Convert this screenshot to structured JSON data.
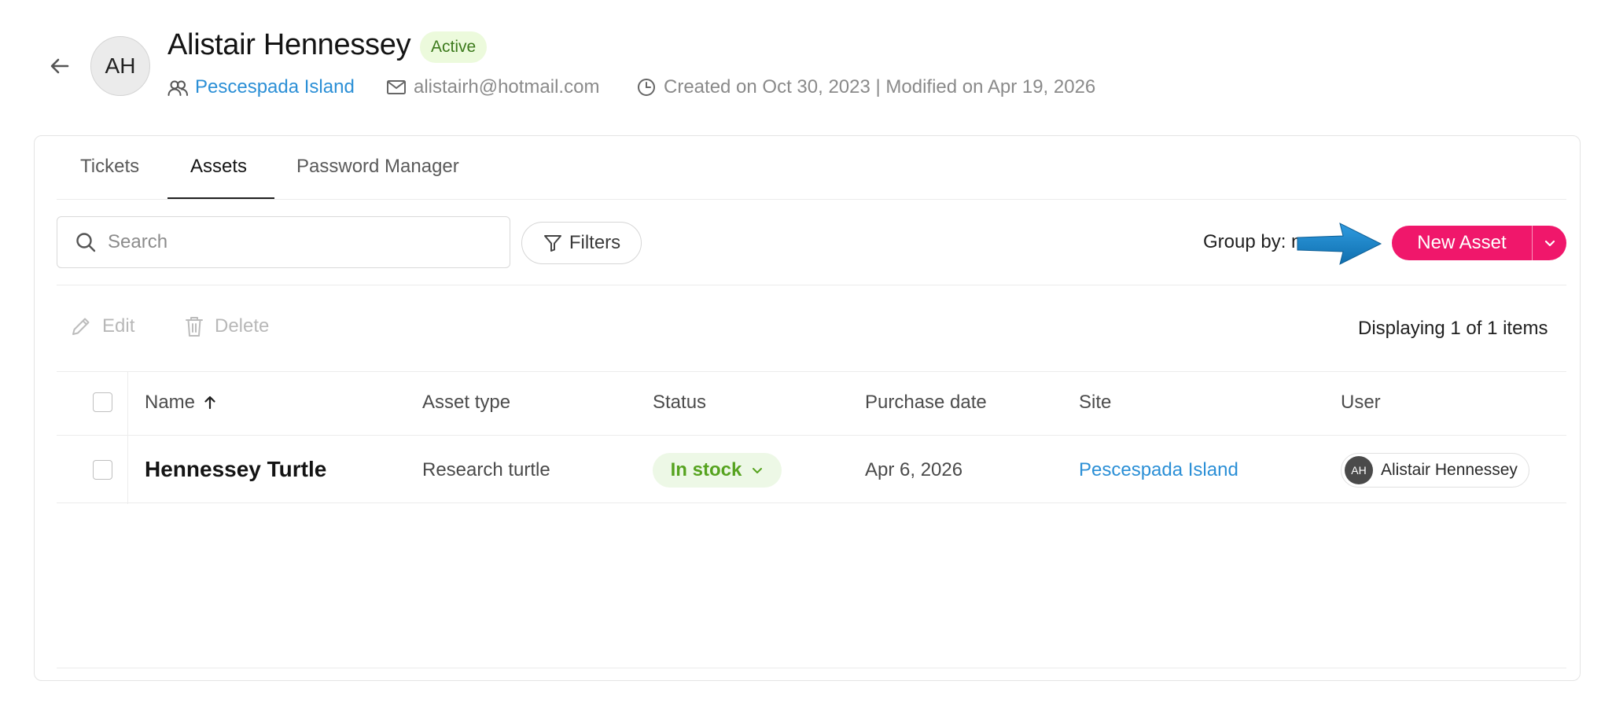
{
  "header": {
    "back_icon": "arrow-left-icon",
    "avatar_initials": "AH",
    "name": "Alistair Hennessey",
    "status_badge": "Active",
    "group": "Pescespada Island",
    "email": "alistairh@hotmail.com",
    "dates": "Created on Oct 30, 2023 | Modified on Apr 19, 2026"
  },
  "tabs": [
    {
      "label": "Tickets",
      "active": false
    },
    {
      "label": "Assets",
      "active": true
    },
    {
      "label": "Password Manager",
      "active": false
    }
  ],
  "toolbar": {
    "search_placeholder": "Search",
    "filters_label": "Filters",
    "group_by_label": "Group by: n",
    "new_asset_label": "New Asset"
  },
  "actions": {
    "edit_label": "Edit",
    "delete_label": "Delete",
    "displaying": "Displaying 1 of 1 items"
  },
  "table": {
    "columns": [
      "Name",
      "Asset type",
      "Status",
      "Purchase date",
      "Site",
      "User"
    ],
    "sort": {
      "column": "Name",
      "direction": "ascending"
    },
    "rows": [
      {
        "name": "Hennessey Turtle",
        "asset_type": "Research turtle",
        "status": "In stock",
        "purchase_date": "Apr 6, 2026",
        "site": "Pescespada Island",
        "user_initials": "AH",
        "user_name": "Alistair Hennessey"
      }
    ]
  },
  "colors": {
    "accent": "#f0176b",
    "link": "#2b8fd6",
    "status_green": "#56a31f",
    "annotation_arrow": "#1a7fc4"
  }
}
